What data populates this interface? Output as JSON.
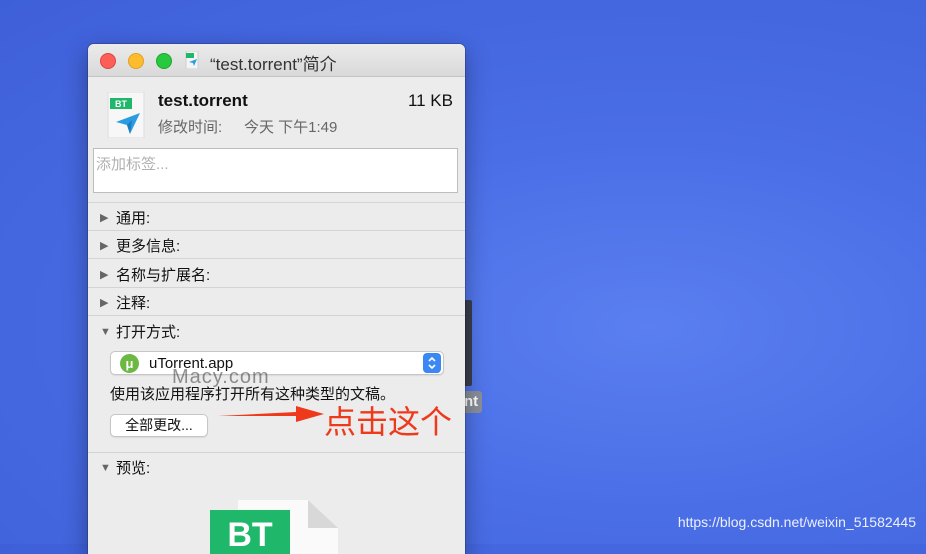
{
  "window": {
    "title": "“test.torrent”简介",
    "file_name": "test.torrent",
    "file_size": "11 KB",
    "modified_label": "修改时间:",
    "modified_value": "今天 下午1:49",
    "file_badge": "BT"
  },
  "tags": {
    "placeholder": "添加标签..."
  },
  "sections": {
    "general": "通用:",
    "more_info": "更多信息:",
    "name_ext": "名称与扩展名:",
    "comments": "注释:",
    "open_with": "打开方式:",
    "preview": "预览:"
  },
  "open_with": {
    "app": "uTorrent.app",
    "app_badge": "μ",
    "description": "使用该应用程序打开所有这种类型的文稿。",
    "change_all": "全部更改..."
  },
  "preview": {
    "badge": "BT"
  },
  "overlays": {
    "annotation": "点击这个",
    "watermark": "Macy.com",
    "credit": "https://blog.csdn.net/weixin_51582445",
    "behind_label": "nt"
  },
  "colors": {
    "desktop": "#4a6ee6",
    "accent": "#3b88f5",
    "bt_green": "#1fb86a",
    "annotation_red": "#ee3a1b"
  },
  "icons": [
    "bt-file-icon",
    "triangle-right-icon",
    "triangle-down-icon",
    "utorrent-icon",
    "chevron-up-down-icon",
    "arrow-right-icon"
  ]
}
